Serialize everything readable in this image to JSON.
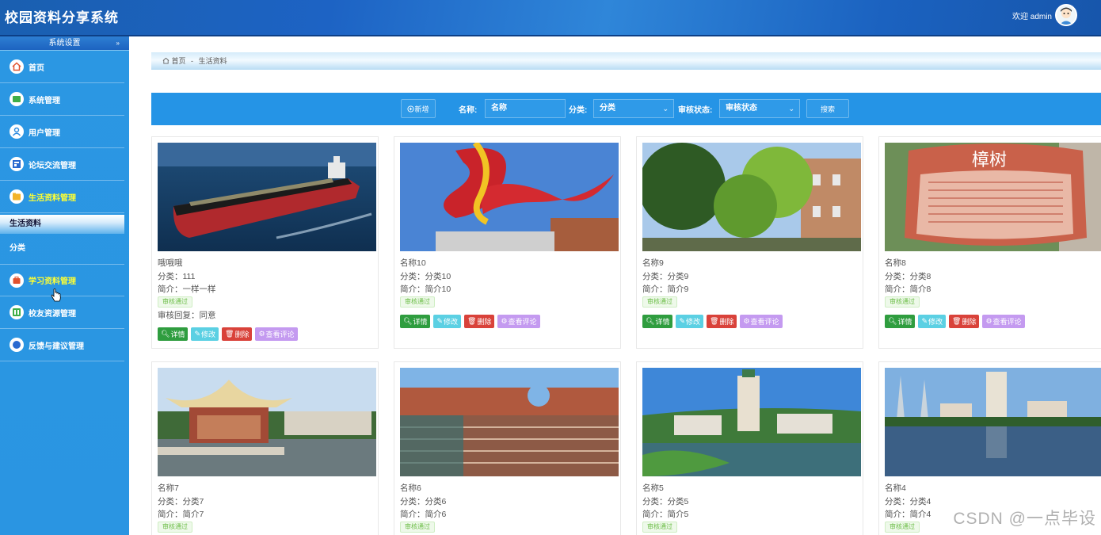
{
  "header": {
    "title": "校园资料分享系统",
    "welcome": "欢迎 admin"
  },
  "sidebar": {
    "section_title": "系统设置",
    "section_arrow": "»",
    "items": [
      {
        "label": "首页",
        "icon": "home-icon"
      },
      {
        "label": "系统管理",
        "icon": "system-icon"
      },
      {
        "label": "用户管理",
        "icon": "user-icon"
      },
      {
        "label": "论坛交流管理",
        "icon": "forum-icon"
      },
      {
        "label": "生活资料管理",
        "icon": "folder-icon"
      }
    ],
    "sub_header": "生活资料",
    "sub_items": [
      {
        "label": "分类"
      }
    ],
    "items2": [
      {
        "label": "学习资料管理",
        "icon": "book-icon"
      },
      {
        "label": "校友资源管理",
        "icon": "alumni-icon"
      },
      {
        "label": "反馈与建议管理",
        "icon": "feedback-icon"
      }
    ]
  },
  "breadcrumb": {
    "home": "首页",
    "sep": "-",
    "current": "生活资料"
  },
  "toolbar": {
    "add_label": "新增",
    "name_label": "名称:",
    "name_placeholder": "名称",
    "category_label": "分类:",
    "category_value": "分类",
    "status_label": "审核状态:",
    "status_value": "审核状态",
    "search_label": "搜索"
  },
  "cards": [
    {
      "name": "哦哦哦",
      "category": "分类：111",
      "intro": "简介：一样一样",
      "status": "审核通过",
      "reply": "审核回复：同意"
    },
    {
      "name": "名称10",
      "category": "分类：分类10",
      "intro": "简介：简介10",
      "status": "审核通过"
    },
    {
      "name": "名称9",
      "category": "分类：分类9",
      "intro": "简介：简介9",
      "status": "审核通过"
    },
    {
      "name": "名称8",
      "category": "分类：分类8",
      "intro": "简介：简介8",
      "status": "审核通过"
    },
    {
      "name": "名称7",
      "category": "分类：分类7",
      "intro": "简介：简介7",
      "status": "审核通过"
    },
    {
      "name": "名称6",
      "category": "分类：分类6",
      "intro": "简介：简介6",
      "status": "审核通过"
    },
    {
      "name": "名称5",
      "category": "分类：分类5",
      "intro": "简介：简介5",
      "status": "审核通过"
    },
    {
      "name": "名称4",
      "category": "分类：分类4",
      "intro": "简介：简介4",
      "status": "审核通过"
    }
  ],
  "actions": {
    "detail": "详情",
    "edit": "修改",
    "delete": "删除",
    "comments": "查看评论"
  },
  "photo_texts": {
    "card4_sign": "樟树"
  },
  "watermark": "CSDN @一点毕设",
  "colors": {
    "primary": "#2594e6",
    "header": "#1d63c4",
    "active_menu": "#ffff33",
    "detail": "#2f9d3f",
    "edit": "#5bd0e3",
    "delete": "#d9423a",
    "comments": "#c49af0"
  }
}
